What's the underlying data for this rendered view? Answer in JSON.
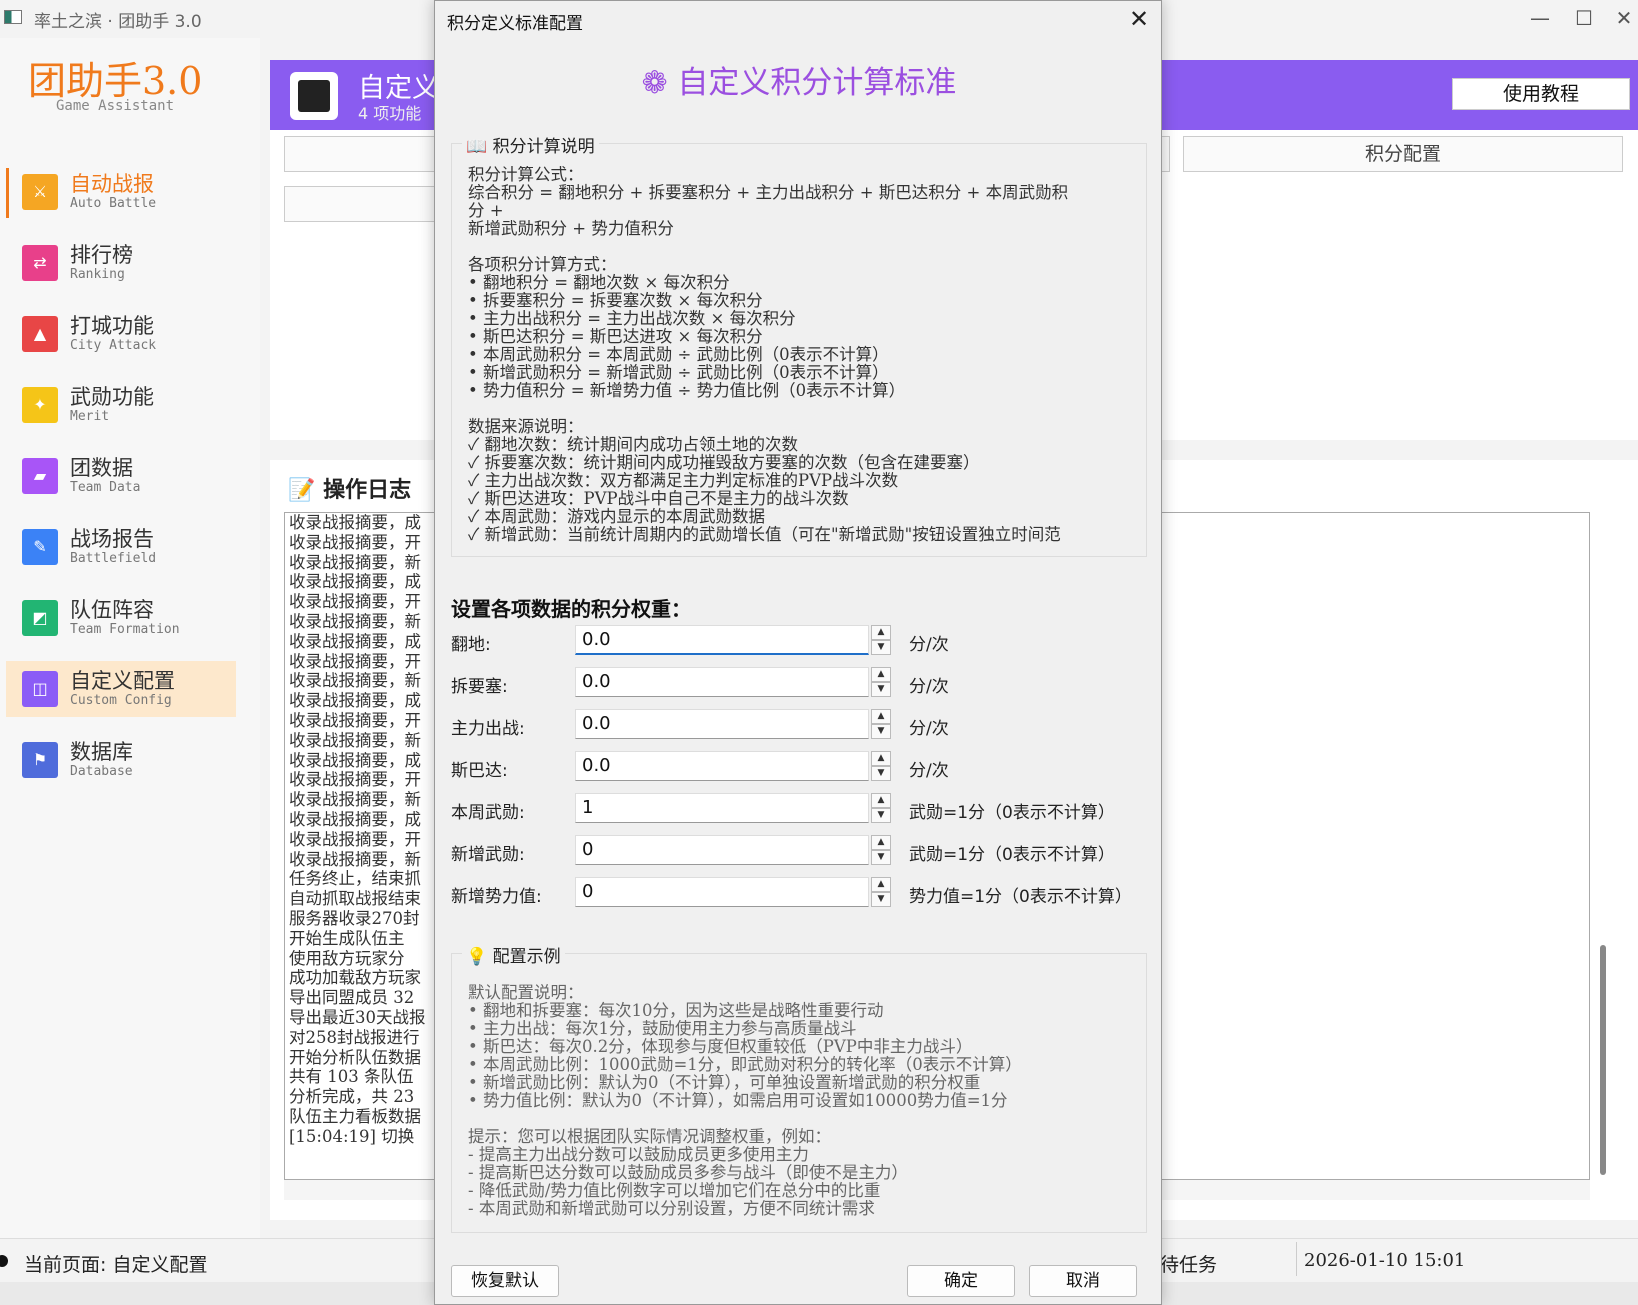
{
  "window": {
    "title": "率土之滨 · 团助手 3.0",
    "minimize": "—",
    "maximize": "☐",
    "close": "✕"
  },
  "sidebar": {
    "logo": "团助手3.0",
    "logo_sub": "Game Assistant",
    "items": [
      {
        "label": "自动战报",
        "sub": "Auto Battle",
        "color": "#f5a623"
      },
      {
        "label": "排行榜",
        "sub": "Ranking",
        "color": "#e8408a"
      },
      {
        "label": "打城功能",
        "sub": "City Attack",
        "color": "#e84646"
      },
      {
        "label": "武勋功能",
        "sub": "Merit",
        "color": "#f5c518"
      },
      {
        "label": "团数据",
        "sub": "Team Data",
        "color": "#a855f7"
      },
      {
        "label": "战场报告",
        "sub": "Battlefield",
        "color": "#3b82f6"
      },
      {
        "label": "队伍阵容",
        "sub": "Team Formation",
        "color": "#22b573"
      },
      {
        "label": "自定义配置",
        "sub": "Custom Config",
        "color": "#8b5cf6"
      },
      {
        "label": "数据库",
        "sub": "Database",
        "color": "#4f6cdb"
      }
    ]
  },
  "banner": {
    "title": "自定义",
    "subtitle": "4 项功能",
    "help_button": "使用教程"
  },
  "tabs": {
    "score_config": "积分配置"
  },
  "log": {
    "title": "操作日志",
    "lines": [
      "收录战报摘要，成",
      "收录战报摘要，开",
      "收录战报摘要，新",
      "收录战报摘要，成",
      "收录战报摘要，开",
      "收录战报摘要，新",
      "收录战报摘要，成",
      "收录战报摘要，开",
      "收录战报摘要，新",
      "收录战报摘要，成",
      "收录战报摘要，开",
      "收录战报摘要，新",
      "收录战报摘要，成",
      "收录战报摘要，开",
      "收录战报摘要，新",
      "收录战报摘要，成",
      "收录战报摘要，开",
      "收录战报摘要，新",
      "任务终止，结束抓",
      "自动抓取战报结束",
      "服务器收录270封",
      "开始生成队伍主",
      "使用敌方玩家分",
      "成功加载敌方玩家",
      "导出同盟成员 32",
      "导出最近30天战报",
      "对258封战报进行",
      "开始分析队伍数据",
      "共有 103 条队伍",
      "分析完成，共 23",
      "队伍主力看板数据",
      "[15:04:19] 切换"
    ]
  },
  "status": {
    "page": "当前页面: 自定义配置",
    "task": "待任务",
    "time": "2026-01-10 15:01"
  },
  "dialog": {
    "title": "积分定义标准配置",
    "close": "✕",
    "heading": "❁ 自定义积分计算标准",
    "explain_title": "📖 积分计算说明",
    "explain_text": "积分计算公式：\n综合积分 = 翻地积分 + 拆要塞积分 + 主力出战积分 + 斯巴达积分 + 本周武勋积\n分 +\n新增武勋积分 + 势力值积分\n\n各项积分计算方式：\n• 翻地积分 = 翻地次数 × 每次积分\n• 拆要塞积分 = 拆要塞次数 × 每次积分\n• 主力出战积分 = 主力出战次数 × 每次积分\n• 斯巴达积分 = 斯巴达进攻 × 每次积分\n• 本周武勋积分 = 本周武勋 ÷ 武勋比例（0表示不计算）\n• 新增武勋积分 = 新增武勋 ÷ 武勋比例（0表示不计算）\n• 势力值积分 = 新增势力值 ÷ 势力值比例（0表示不计算）\n\n数据来源说明：\n✓ 翻地次数：统计期间内成功占领土地的次数\n✓ 拆要塞次数：统计期间内成功摧毁敌方要塞的次数（包含在建要塞）\n✓ 主力出战次数：双方都满足主力判定标准的PVP战斗次数\n✓ 斯巴达进攻：PVP战斗中自己不是主力的战斗次数\n✓ 本周武勋：游戏内显示的本周武勋数据\n✓ 新增武勋：当前统计周期内的武勋增长值（可在\"新增武勋\"按钮设置独立时间范",
    "weights_title": "设置各项数据的积分权重：",
    "weights": [
      {
        "label": "翻地:",
        "value": "0.0",
        "unit": "分/次"
      },
      {
        "label": "拆要塞:",
        "value": "0.0",
        "unit": "分/次"
      },
      {
        "label": "主力出战:",
        "value": "0.0",
        "unit": "分/次"
      },
      {
        "label": "斯巴达:",
        "value": "0.0",
        "unit": "分/次"
      },
      {
        "label": "本周武勋:",
        "value": "1",
        "unit": "武勋=1分（0表示不计算）"
      },
      {
        "label": "新增武勋:",
        "value": "0",
        "unit": "武勋=1分（0表示不计算）"
      },
      {
        "label": "新增势力值:",
        "value": "0",
        "unit": "势力值=1分（0表示不计算）"
      }
    ],
    "example_title": "💡 配置示例",
    "example_text": "默认配置说明：\n• 翻地和拆要塞：每次10分，因为这些是战略性重要行动\n• 主力出战：每次1分，鼓励使用主力参与高质量战斗\n• 斯巴达：每次0.2分，体现参与度但权重较低（PVP中非主力战斗）\n• 本周武勋比例：1000武勋=1分，即武勋对积分的转化率（0表示不计算）\n• 新增武勋比例：默认为0（不计算），可单独设置新增武勋的积分权重\n• 势力值比例：默认为0（不计算），如需启用可设置如10000势力值=1分\n\n提示：您可以根据团队实际情况调整权重，例如：\n- 提高主力出战分数可以鼓励成员更多使用主力\n- 提高斯巴达分数可以鼓励成员多参与战斗（即使不是主力）\n- 降低武勋/势力值比例数字可以增加它们在总分中的比重\n- 本周武勋和新增武勋可以分别设置，方便不同统计需求",
    "buttons": {
      "reset": "恢复默认",
      "ok": "确定",
      "cancel": "取消"
    },
    "spin_up": "▲",
    "spin_down": "▼"
  }
}
